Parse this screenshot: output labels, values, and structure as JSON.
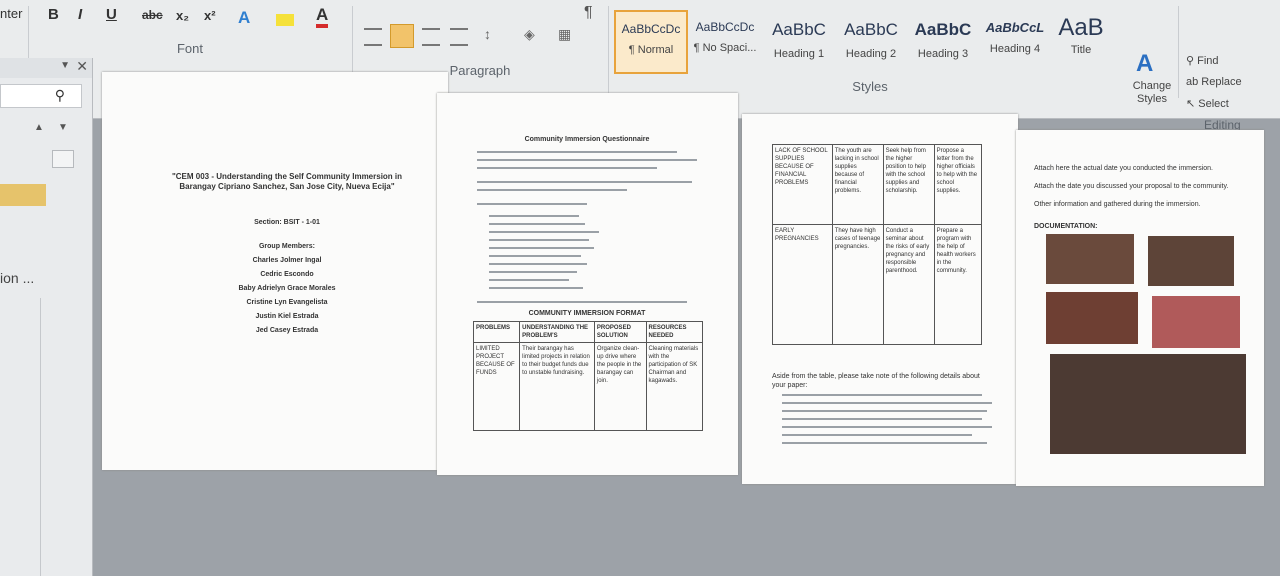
{
  "ribbon": {
    "left_label": "nter",
    "font_group_label": "Font",
    "paragraph_group_label": "Paragraph",
    "styles_group_label": "Styles",
    "editing_group_label": "Editing",
    "font_buttons": [
      "B",
      "I",
      "U",
      "abc",
      "x₂",
      "x²"
    ],
    "styles": [
      {
        "sample": "AaBbCcDc",
        "name": "¶ Normal"
      },
      {
        "sample": "AaBbCcDc",
        "name": "¶ No Spaci..."
      },
      {
        "sample": "AaBbC",
        "name": "Heading 1"
      },
      {
        "sample": "AaBbC",
        "name": "Heading 2"
      },
      {
        "sample": "AaBbC",
        "name": "Heading 3"
      },
      {
        "sample": "AaBbCcL",
        "name": "Heading 4"
      },
      {
        "sample": "AaB",
        "name": "Title"
      }
    ],
    "change_styles_label": "Change Styles",
    "find_label": "Find",
    "replace_label": "Replace",
    "select_label": "Select"
  },
  "nav_pane": {
    "partial_text": "ion ..."
  },
  "pages": {
    "p1": {
      "title": "\"CEM 003 - Understanding the Self Community Immersion in Barangay Cipriano Sanchez, San Jose City, Nueva Ecija\"",
      "section": "Section: BSIT - 1-01",
      "members_label": "Group Members:",
      "members": [
        "Charles Jolmer Ingal",
        "Cedric Escondo",
        "Baby Adrielyn Grace Morales",
        "Cristine Lyn Evangelista",
        "Justin Kiel Estrada",
        "Jed Casey Estrada"
      ]
    },
    "p2": {
      "heading": "Community Immersion Questionnaire",
      "table_title": "COMMUNITY IMMERSION FORMAT",
      "table_headers": [
        "PROBLEMS",
        "UNDERSTANDING THE PROBLEM'S",
        "PROPOSED SOLUTION",
        "RESOURCES NEEDED"
      ],
      "table_row": [
        "LIMITED PROJECT BECAUSE OF FUNDS",
        "Their barangay has limited projects in relation to their budget funds due to unstable fundraising.",
        "Organize clean-up drive where the people in the barangay can join.",
        "Cleaning materials with the participation of SK Chairman and kagawads."
      ]
    },
    "p3": {
      "row1": [
        "LACK OF SCHOOL SUPPLIES BECAUSE OF FINANCIAL PROBLEMS",
        "The youth are lacking in school supplies because of financial problems.",
        "Seek help from the higher position to help with the school supplies and scholarship.",
        "Propose a letter from the higher officials to help with the school supplies."
      ],
      "row2": [
        "EARLY PREGNANCIES",
        "They have high cases of teenage pregnancies.",
        "Conduct a seminar about the risks of early pregnancy and responsible parenthood.",
        "Prepare a program with the help of health workers in the community."
      ],
      "note": "Aside from the table, please take note of the following details about your paper:"
    },
    "p4": {
      "bullets": [
        "Attach here the actual date you conducted the immersion.",
        "Attach the date you discussed your proposal to the community.",
        "Other information and gathered during the immersion."
      ],
      "doc_label": "DOCUMENTATION:"
    }
  }
}
